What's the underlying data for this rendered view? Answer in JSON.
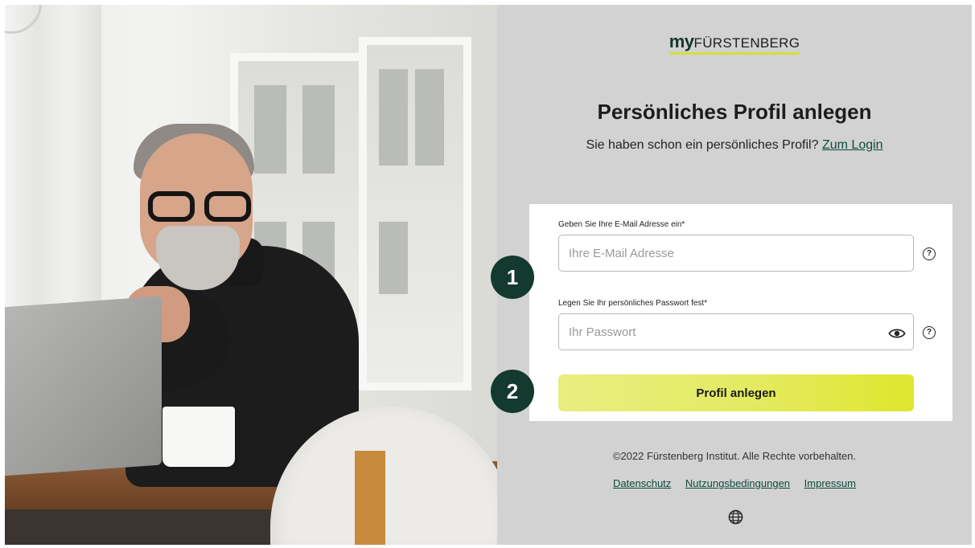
{
  "logo": {
    "prefix": "my",
    "name": "FÜRSTENBERG"
  },
  "page": {
    "title": "Persönliches Profil anlegen",
    "subtitle_text": "Sie haben schon ein persönliches Profil?",
    "login_link": "Zum Login"
  },
  "form": {
    "email": {
      "label": "Geben Sie Ihre E-Mail Adresse ein*",
      "placeholder": "Ihre E-Mail Adresse",
      "value": ""
    },
    "password": {
      "label": "Legen Sie Ihr persönliches Passwort fest*",
      "placeholder": "Ihr Passwort",
      "value": ""
    },
    "help_symbol": "?",
    "submit_label": "Profil anlegen"
  },
  "steps": [
    "1",
    "2"
  ],
  "footer": {
    "copyright": "©2022 Fürstenberg Institut. Alle Rechte vorbehalten.",
    "links": [
      "Datenschutz",
      "Nutzungsbedingungen",
      "Impressum"
    ]
  },
  "icons": {
    "help": "question-circle",
    "password_visibility": "eye",
    "language": "globe"
  },
  "colors": {
    "brand_dark_green": "#14392f",
    "accent_lime": "#d4e03a",
    "panel_background": "#d2d2d2",
    "link": "#0f4a3b"
  }
}
